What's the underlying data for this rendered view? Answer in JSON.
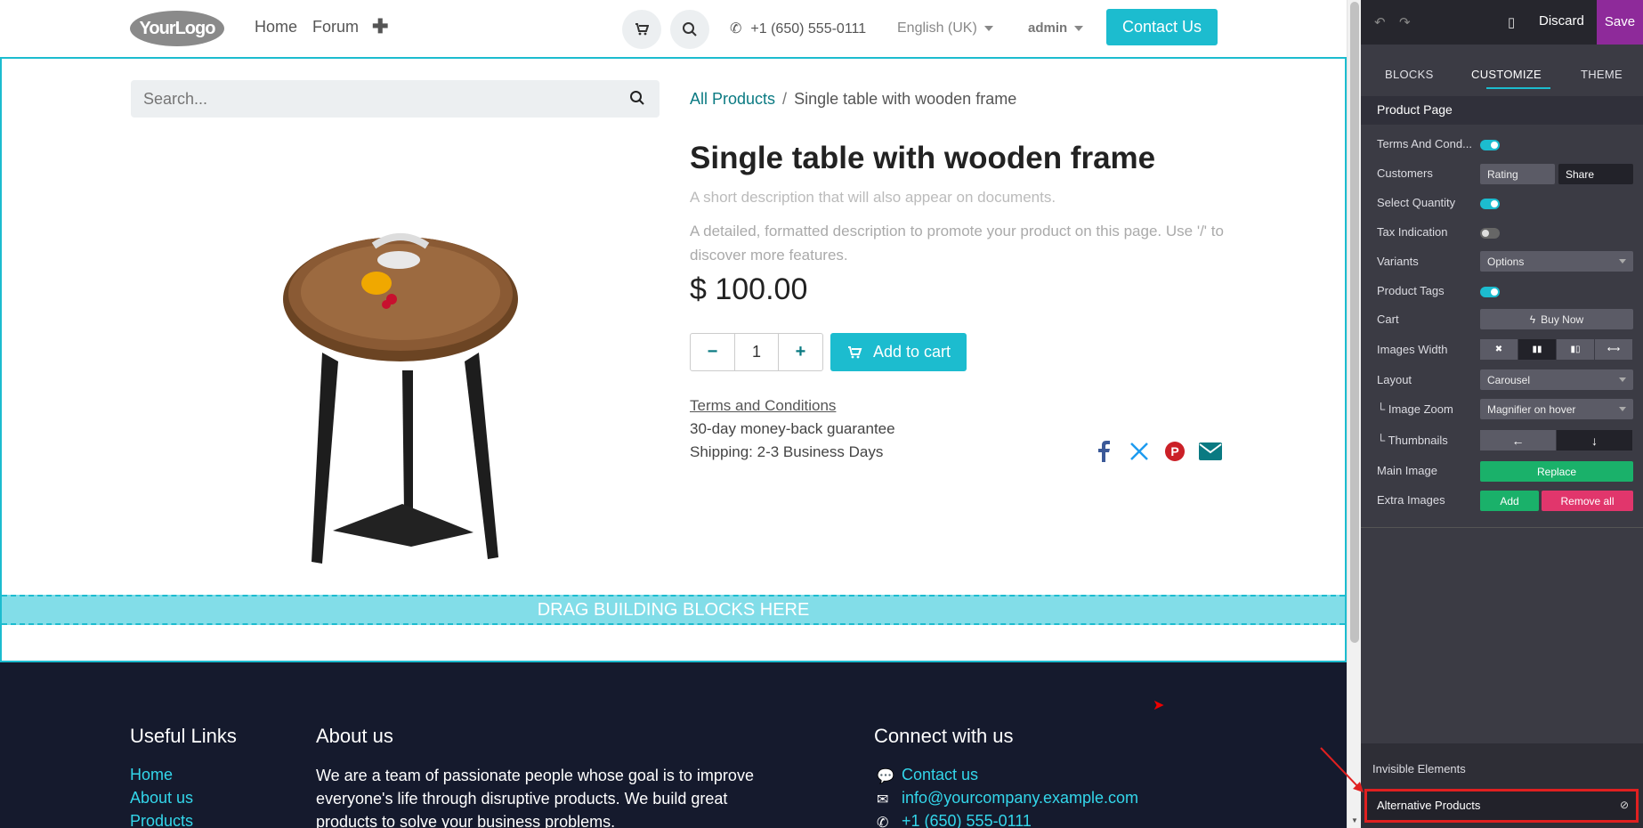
{
  "header": {
    "logo_text": "YourLogo",
    "nav": [
      "Home",
      "Forum"
    ],
    "phone": "+1 (650) 555-0111",
    "language": "English (UK)",
    "user": "admin",
    "contact_label": "Contact Us"
  },
  "search": {
    "placeholder": "Search..."
  },
  "breadcrumb": {
    "parent": "All Products",
    "separator": "/",
    "current": "Single table with wooden frame"
  },
  "product": {
    "name": "Single table with wooden frame",
    "short_description": "A short description that will also appear on documents.",
    "description": "A detailed, formatted description to promote your product on this page. Use '/' to discover more features.",
    "price": "$ 100.00",
    "quantity": "1",
    "add_to_cart": "Add to cart",
    "terms": "Terms and Conditions",
    "guarantee": "30-day money-back guarantee",
    "shipping": "Shipping: 2-3 Business Days"
  },
  "drag_area": "DRAG BUILDING BLOCKS HERE",
  "footer": {
    "useful_links_title": "Useful Links",
    "links": [
      "Home",
      "About us",
      "Products"
    ],
    "about_title": "About us",
    "about_text": "We are a team of passionate people whose goal is to improve everyone's life through disruptive products. We build great products to solve your business problems.",
    "connect_title": "Connect with us",
    "connect_contact": "Contact us",
    "connect_email": "info@yourcompany.example.com",
    "connect_phone": "+1 (650) 555-0111"
  },
  "editor": {
    "discard": "Discard",
    "save": "Save",
    "tabs": [
      "BLOCKS",
      "CUSTOMIZE",
      "THEME"
    ],
    "section_title": "Product Page",
    "rows": {
      "terms": "Terms And Cond...",
      "customers": "Customers",
      "customers_rating": "Rating",
      "customers_share": "Share",
      "select_quantity": "Select Quantity",
      "tax_indication": "Tax Indication",
      "variants": "Variants",
      "variants_value": "Options",
      "product_tags": "Product Tags",
      "cart": "Cart",
      "cart_value": "Buy Now",
      "images_width": "Images Width",
      "layout": "Layout",
      "layout_value": "Carousel",
      "image_zoom": "Image Zoom",
      "image_zoom_value": "Magnifier on hover",
      "thumbnails": "Thumbnails",
      "main_image": "Main Image",
      "main_image_btn": "Replace",
      "extra_images": "Extra Images",
      "extra_add": "Add",
      "extra_remove": "Remove all"
    },
    "invisible_title": "Invisible Elements",
    "invisible_item": "Alternative Products"
  },
  "colors": {
    "accent": "#1cbccf",
    "save_purple": "#8e2a9a",
    "green": "#1ab16a",
    "pink": "#e1366c",
    "footer_bg": "#151a2d"
  }
}
